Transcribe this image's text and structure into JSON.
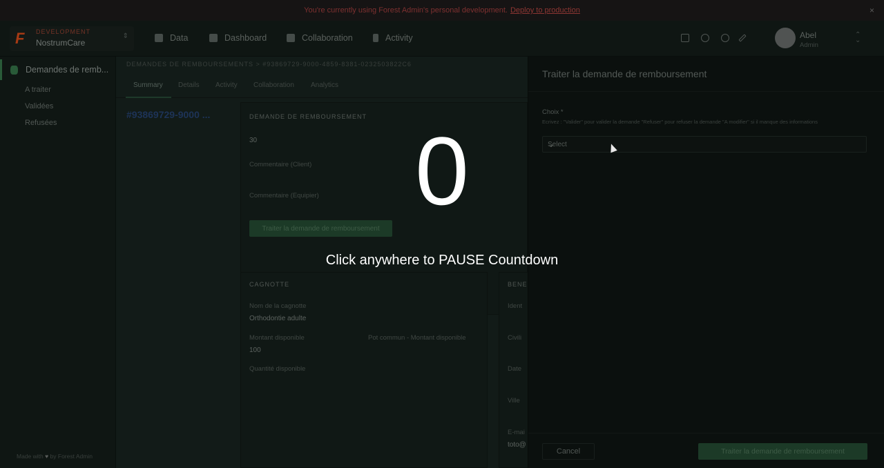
{
  "banner": {
    "text": "You're currently using Forest Admin's personal development.",
    "link": "Deploy to production",
    "close": "×"
  },
  "project": {
    "environment": "DEVELOPMENT",
    "name": "NostrumCare"
  },
  "nav": [
    {
      "label": "Data",
      "icon": "list-icon"
    },
    {
      "label": "Dashboard",
      "icon": "grid-icon"
    },
    {
      "label": "Collaboration",
      "icon": "chat-icon"
    },
    {
      "label": "Activity",
      "icon": "bolt-icon"
    }
  ],
  "user": {
    "name": "Abel",
    "role": "Admin"
  },
  "sidebar": {
    "active": "Demandes de remb...",
    "items": [
      "A traiter",
      "Validées",
      "Refusées"
    ],
    "made_with_prefix": "Made with",
    "made_with_suffix": "by Forest Admin"
  },
  "main": {
    "breadcrumb": "DEMANDES DE REMBOURSEMENTS  >  #93869729-9000-4859-8381-0232503822C6",
    "tabs": [
      "Summary",
      "Details",
      "Activity",
      "Collaboration",
      "Analytics"
    ],
    "record_id": "#93869729-9000 ...",
    "demande": {
      "title": "DEMANDE DE REMBOURSEMENT",
      "value": "30",
      "comment_client": "Commentaire (Client)",
      "comment_equipier": "Commentaire (Equipier)",
      "button": "Traiter la demande de remboursement"
    },
    "cagnotte": {
      "title": "CAGNOTTE",
      "name_label": "Nom de la cagnotte",
      "name_value": "Orthodontie adulte",
      "montant_label": "Montant disponible",
      "montant_value": "100",
      "pot_label": "Pot commun - Montant disponible",
      "quantite_label": "Quantité disponible"
    },
    "beneficiaire": {
      "title": "BENE",
      "labels": [
        "Ident",
        "Civili",
        "Date",
        "Ville",
        "E-mai"
      ],
      "email_value": "toto@"
    }
  },
  "drawer": {
    "title": "Traiter la demande de remboursement",
    "choix_label": "Choix *",
    "help": "Ecrivez : \"Valider\" pour valider la demande \"Refuser\" pour refuser la demande \"A modifier\" si il manque des informations",
    "select_placeholder": "Select",
    "cancel": "Cancel",
    "submit": "Traiter la demande de remboursement"
  },
  "countdown": {
    "number": "0",
    "message": "Click anywhere to PAUSE Countdown"
  }
}
